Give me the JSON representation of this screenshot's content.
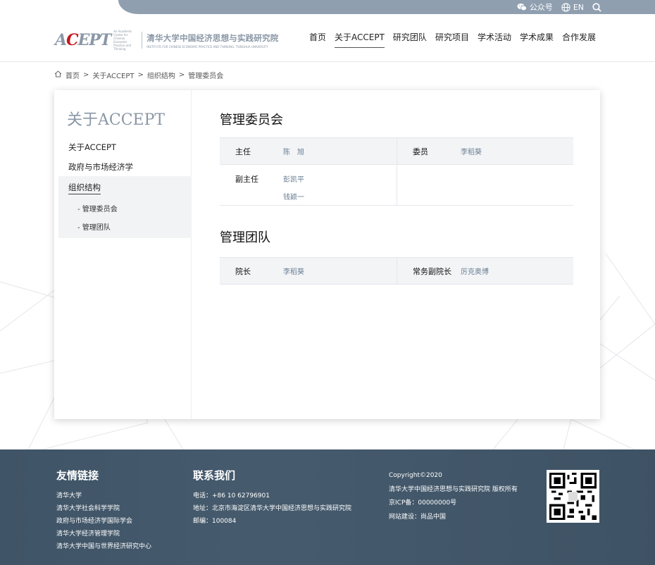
{
  "topbar": {
    "wechat_label": "公众号",
    "lang_label": "EN"
  },
  "header": {
    "logo_text_a": "A",
    "logo_text_c": "C",
    "logo_text_rest": "EPT",
    "logo_small": "An Academic Center for Chinese Economic Practice and Thinking",
    "logo_cn": "清华大学中国经济思想与实践研究院",
    "logo_en": "INSTITUTE FOR CHINESE ECONOMIC PRACTICE AND THINKING, TSINGHUA UNIVERSITY",
    "nav": [
      "首页",
      "关于ACCEPT",
      "研究团队",
      "研究项目",
      "学术活动",
      "学术成果",
      "合作发展"
    ],
    "active_nav": "关于ACCEPT"
  },
  "breadcrumb": {
    "items": [
      "首页",
      "关于ACCEPT",
      "组织结构",
      "管理委员会"
    ],
    "separator": ">"
  },
  "sidebar": {
    "title": "关于ACCEPT",
    "items": [
      "关于ACCEPT",
      "政府与市场经济学",
      "组织结构"
    ],
    "active_item": "组织结构",
    "subitems": [
      "- 管理委员会",
      "- 管理团队"
    ]
  },
  "committee": {
    "title": "管理委员会",
    "chair_label": "主任",
    "chair_value": "陈　旭",
    "member_label": "委员",
    "member_value": "李稻葵",
    "vice_label": "副主任",
    "vice_values": [
      "彭凯平",
      "钱颖一"
    ]
  },
  "team": {
    "title": "管理团队",
    "dean_label": "院长",
    "dean_value": "李稻葵",
    "exec_label": "常务副院长",
    "exec_value": "厉克奥博"
  },
  "footer": {
    "links_title": "友情链接",
    "links": [
      "清华大学",
      "清华大学社会科学学院",
      "政府与市场经济学国际学会",
      "清华大学经济管理学院",
      "清华大学中国与世界经济研究中心"
    ],
    "contact_title": "联系我们",
    "phone": "电话：+86 10 62796901",
    "address": "地址：北京市海淀区清华大学中国经济思想与实践研究院",
    "postcode": "邮编：100084",
    "copyright": "Copyright©2020",
    "rights": "清华大学中国经济思想与实践研究院 版权所有",
    "icp": "京ICP备：00000000号",
    "builder": "网站建设：尚品中国"
  },
  "colors": {
    "accent_gray": "#8a97a6",
    "brand_red": "#c8161d",
    "footer_bg": "#3f5466",
    "value_text": "#6b7f94"
  }
}
